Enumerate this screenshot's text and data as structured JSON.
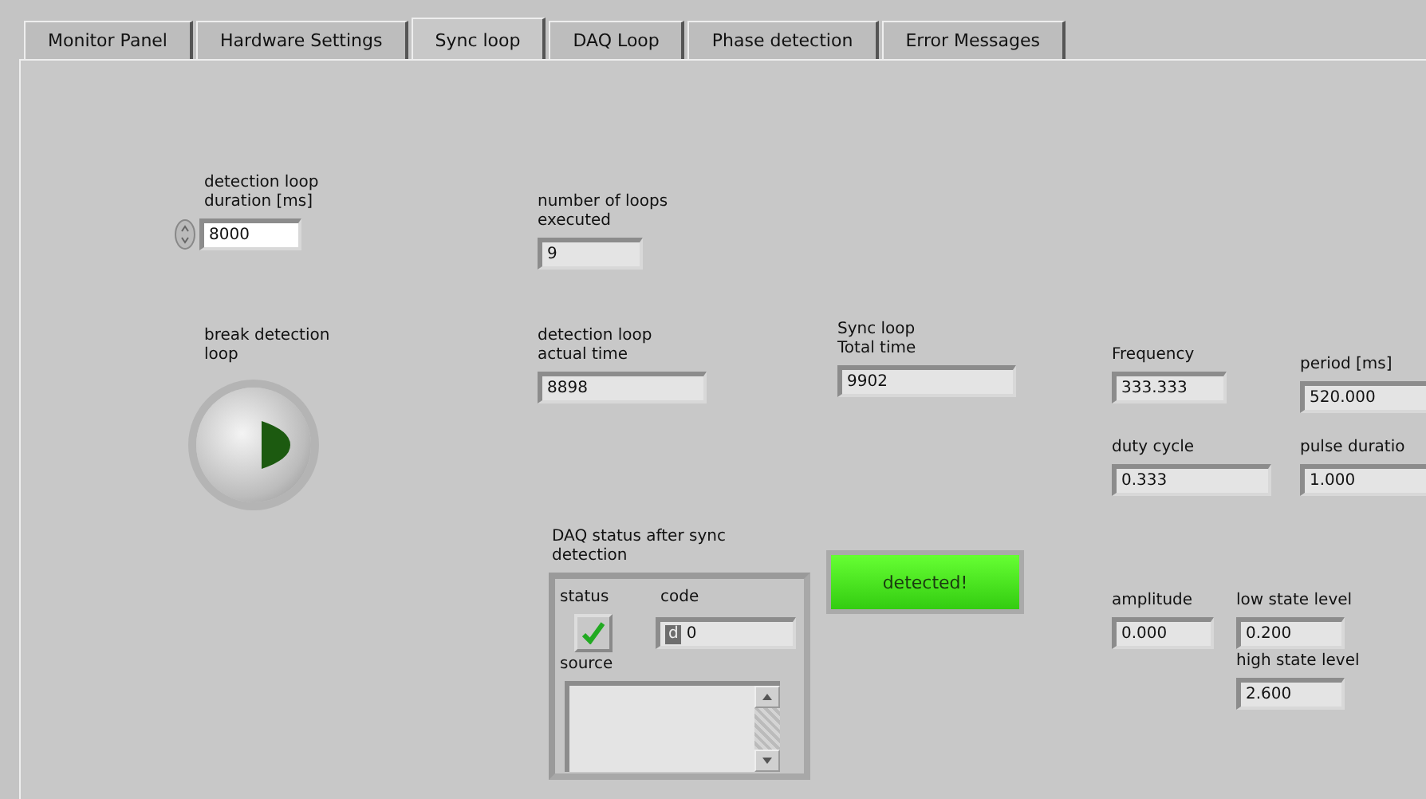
{
  "tabs": [
    {
      "label": "Monitor Panel",
      "selected": false
    },
    {
      "label": "Hardware Settings",
      "selected": false
    },
    {
      "label": "Sync loop",
      "selected": true
    },
    {
      "label": "DAQ Loop",
      "selected": false
    },
    {
      "label": "Phase detection",
      "selected": false
    },
    {
      "label": "Error Messages",
      "selected": false
    }
  ],
  "controls": [
    {
      "kind": "numeric",
      "label": "detection loop duration [ms]",
      "value": "8000"
    },
    {
      "kind": "indicator",
      "label": "number of loops executed",
      "value": "9"
    },
    {
      "kind": "button",
      "label": "break detection loop",
      "on": true
    },
    {
      "kind": "indicator",
      "label": "detection loop actual time",
      "value": "8898"
    },
    {
      "kind": "indicator",
      "label": "Sync loop Total time",
      "value": "9902"
    },
    {
      "kind": "indicator",
      "label": "Frequency",
      "value": "333.333"
    },
    {
      "kind": "indicator",
      "label": "period [ms]",
      "value": "520.000"
    },
    {
      "kind": "indicator",
      "label": "duty cycle",
      "value": "0.333"
    },
    {
      "kind": "indicator",
      "label": "pulse duratio",
      "value": "1.000"
    },
    {
      "kind": "indicator",
      "label": "amplitude",
      "value": "0.000"
    },
    {
      "kind": "indicator",
      "label": "low state level",
      "value": "0.200"
    },
    {
      "kind": "indicator",
      "label": "high state level",
      "value": "2.600"
    }
  ],
  "daq_status": {
    "label": "DAQ status after sync detection",
    "status_label": "status",
    "status": true,
    "code_label": "code",
    "radix": "d",
    "code": "0",
    "source_label": "source"
  },
  "led": {
    "label": "detected!",
    "on": true
  }
}
